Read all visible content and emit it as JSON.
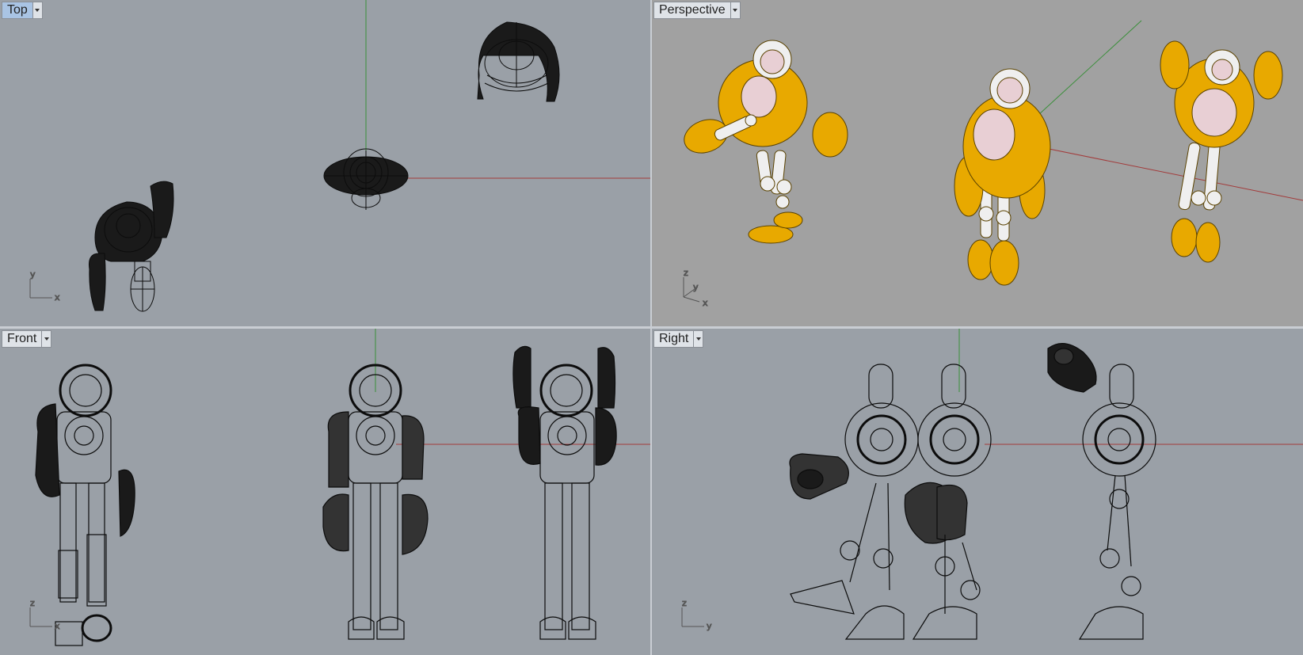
{
  "colors": {
    "frame": "#c9cdd3",
    "viewport_bg": "#9aa0a7",
    "perspective_bg": "#a1a1a1",
    "x_axis": "#a23b3b",
    "y_axis": "#3a8f3a",
    "wire": "#0c0c0c",
    "robot_yellow": "#e8a900",
    "robot_white": "#efefef",
    "robot_visor": "#e8cfd4"
  },
  "viewports": {
    "top": {
      "title": "Top",
      "active": true,
      "axes": {
        "a": "y",
        "b": "x"
      }
    },
    "perspective": {
      "title": "Perspective",
      "active": false,
      "axes": {
        "z": "z",
        "y": "y",
        "x": "x"
      }
    },
    "front": {
      "title": "Front",
      "active": false,
      "axes": {
        "a": "z",
        "b": "x"
      }
    },
    "right": {
      "title": "Right",
      "active": false,
      "axes": {
        "a": "z",
        "b": "y"
      }
    }
  }
}
